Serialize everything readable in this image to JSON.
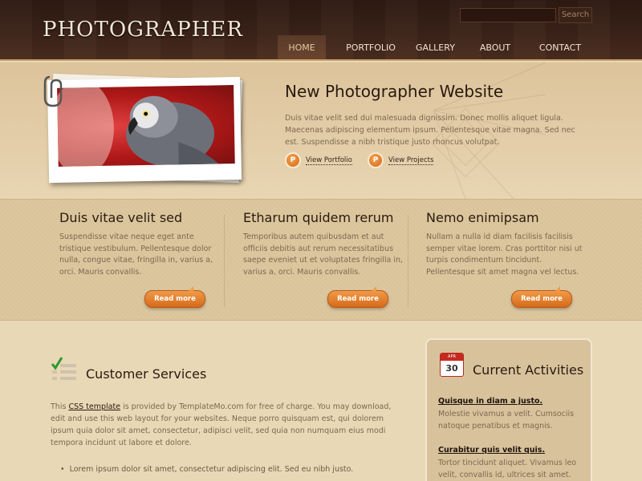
{
  "header": {
    "logo": "PHOTOGRAPHER",
    "search_placeholder": "",
    "search_button": "Search"
  },
  "nav": [
    {
      "label": "HOME",
      "active": true
    },
    {
      "label": "PORTFOLIO",
      "active": false
    },
    {
      "label": "GALLERY",
      "active": false
    },
    {
      "label": "ABOUT",
      "active": false
    },
    {
      "label": "CONTACT",
      "active": false
    }
  ],
  "hero": {
    "title": "New Photographer Website",
    "text": "Duis vitae velit sed dui malesuada dignissim. Donec mollis aliquet ligula. Maecenas adipiscing elementum ipsum. Pellentesque vitae magna. Sed nec est. Suspendisse a nibh tristique justo rhoncus volutpat.",
    "links": [
      {
        "icon": "P",
        "label": "View Portfolio"
      },
      {
        "icon": "P",
        "label": "View Projects"
      }
    ]
  },
  "features": [
    {
      "title": "Duis vitae velit sed",
      "text": "Suspendisse vitae neque eget ante tristique vestibulum. Pellentesque dolor nulla, congue vitae, fringilla in, varius a, orci. Mauris convallis.",
      "button": "Read more"
    },
    {
      "title": "Etharum quidem rerum",
      "text": "Temporibus autem quibusdam et aut officiis debitis aut rerum necessitatibus saepe eveniet ut et voluptates fringilla in, varius a, orci. Mauris convallis.",
      "button": "Read more"
    },
    {
      "title": "Nemo enimipsam",
      "text": "Nullam a nulla id diam facilisis facilisis semper vitae lorem. Cras porttitor nisi ut turpis condimentum tincidunt. Pellentesque sit amet magna vel lectus.",
      "button": "Read more"
    }
  ],
  "services": {
    "title": "Customer Services",
    "intro_before": "This ",
    "intro_link": "CSS template",
    "intro_after": " is provided by TemplateMo.com for free of charge. You may download, edit and use this web layout for your websites. Neque porro quisquam est, qui dolorem ipsum quia dolor sit amet, consectetur, adipisci velit, sed quia non numquam eius modi tempora incidunt ut labore et dolore.",
    "bullets": [
      "Lorem ipsum dolor sit amet, consectetur adipiscing elit. Sed eu nibh justo."
    ]
  },
  "activities": {
    "title": "Current Activities",
    "calendar_month": "APR",
    "calendar_day": "30",
    "items": [
      {
        "title": "Quisque in diam a justo.",
        "text": "Molestie vivamus a velit. Cumsociis natoque penatibus et magnis."
      },
      {
        "title": "Curabitur quis velit quis.",
        "text": "Tortor tincidunt aliquet. Vivamus leo velit, convallis id, ultrices sit amet."
      }
    ]
  },
  "colors": {
    "header_bg": "#3a2218",
    "page_bg": "#e9d8b6",
    "accent_orange": "#e07c2a",
    "heading": "#2a1a0e"
  }
}
